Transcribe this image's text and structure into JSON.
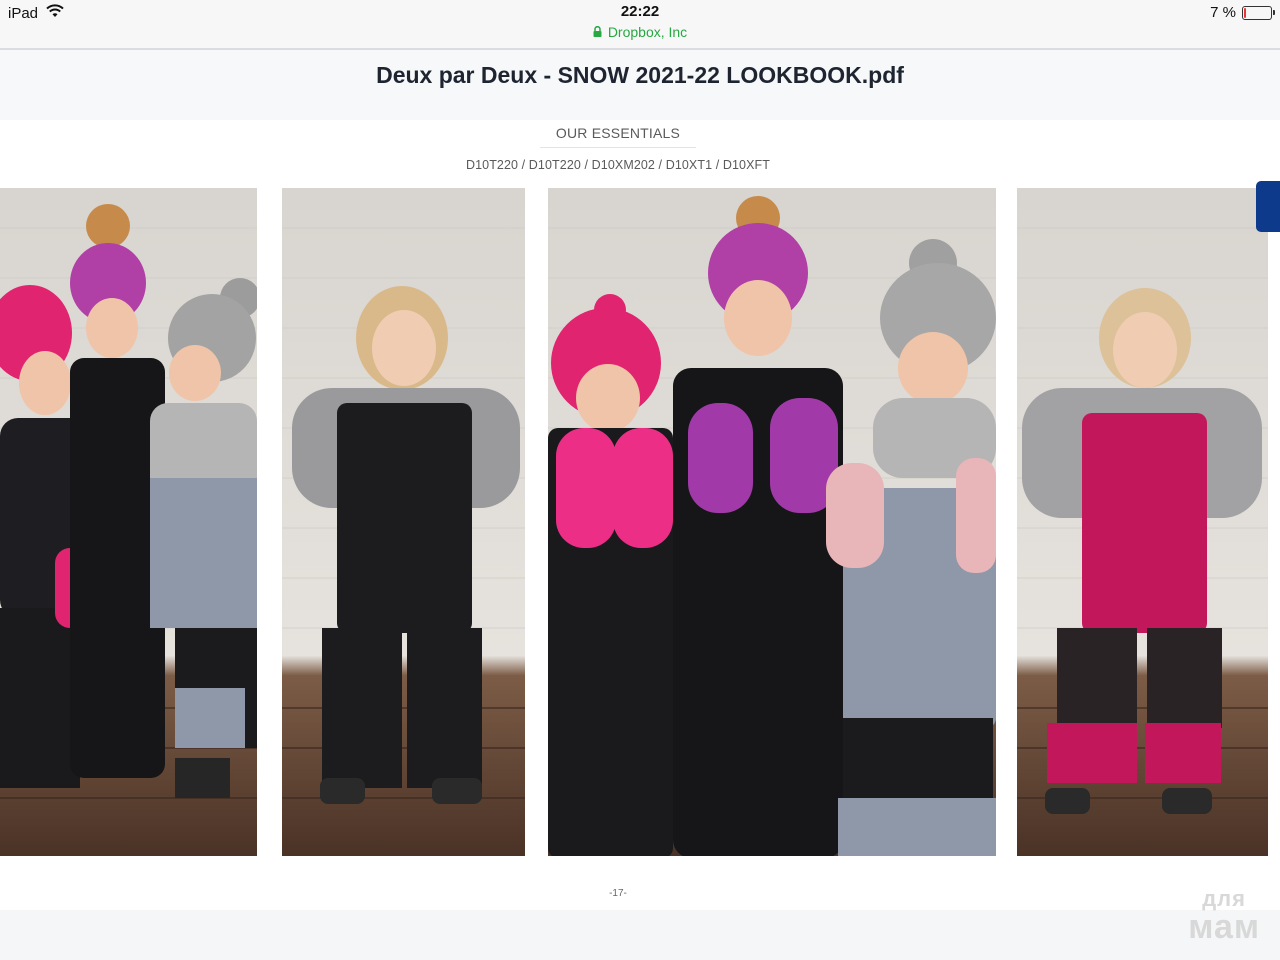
{
  "status_bar": {
    "device": "iPad",
    "time": "22:22",
    "url_host": "Dropbox, Inc",
    "battery_text": "7 %",
    "battery_level": 0.07
  },
  "document": {
    "title": "Deux par Deux - SNOW 2021-22 LOOKBOOK.pdf"
  },
  "page": {
    "section_heading": "OUR ESSENTIALS",
    "product_codes": "D10T220 / D10T220 / D10XM202 / D10XT1 /  D10XFT",
    "page_number": "-17-",
    "photos": [
      "photo-three-girls-left",
      "photo-girl-black-overalls",
      "photo-three-girls-mittens",
      "photo-girl-pink-overalls"
    ]
  },
  "watermark": {
    "line1": "для",
    "line2": "мам"
  },
  "colors": {
    "accent_blue_tab": "#0d3a8a",
    "secure_url_green": "#27a844"
  }
}
